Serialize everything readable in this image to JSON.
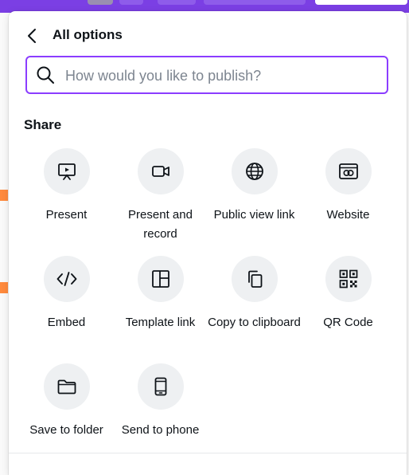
{
  "panel": {
    "title": "All options",
    "search": {
      "placeholder": "How would you like to publish?",
      "value": ""
    },
    "section_title": "Share",
    "options": [
      {
        "label": "Present",
        "icon": "present-icon"
      },
      {
        "label": "Present and record",
        "icon": "video-camera-icon"
      },
      {
        "label": "Public view link",
        "icon": "globe-icon"
      },
      {
        "label": "Website",
        "icon": "website-icon"
      },
      {
        "label": "Embed",
        "icon": "code-icon"
      },
      {
        "label": "Template link",
        "icon": "template-layout-icon"
      },
      {
        "label": "Copy to clipboard",
        "icon": "copy-icon"
      },
      {
        "label": "QR Code",
        "icon": "qr-code-icon"
      },
      {
        "label": "Save to folder",
        "icon": "folder-icon"
      },
      {
        "label": "Send to phone",
        "icon": "phone-icon"
      }
    ]
  },
  "colors": {
    "accent": "#8b3dff",
    "topbar": "#7b3fe4",
    "icon_bg": "#eef0f2"
  }
}
